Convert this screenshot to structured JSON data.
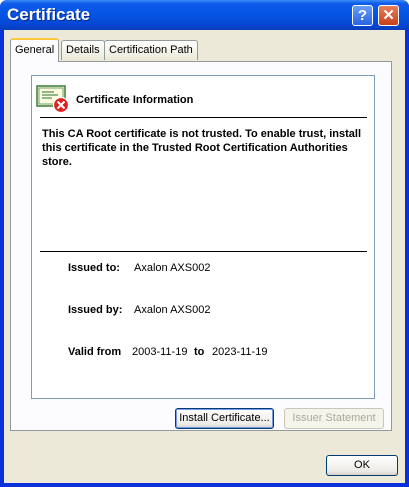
{
  "window": {
    "title": "Certificate"
  },
  "titlebar": {
    "help_glyph": "?",
    "close_glyph": "✕"
  },
  "tabs": [
    {
      "label": "General"
    },
    {
      "label": "Details"
    },
    {
      "label": "Certification Path"
    }
  ],
  "info": {
    "heading": "Certificate Information",
    "message": "This CA Root certificate is not trusted. To enable trust, install this certificate in the Trusted Root Certification Authorities store."
  },
  "fields": {
    "issued_to_label": "Issued to:",
    "issued_to_value": "Axalon AXS002",
    "issued_by_label": "Issued by:",
    "issued_by_value": "Axalon AXS002",
    "valid_from_label": "Valid from",
    "valid_from_value": "2003-11-19",
    "to_label": "to",
    "valid_to_value": "2023-11-19"
  },
  "buttons": {
    "install": "Install Certificate...",
    "issuer": "Issuer Statement",
    "ok": "OK"
  },
  "icons": {
    "certificate": "certificate-error-icon",
    "help": "help-icon",
    "close": "close-icon"
  }
}
